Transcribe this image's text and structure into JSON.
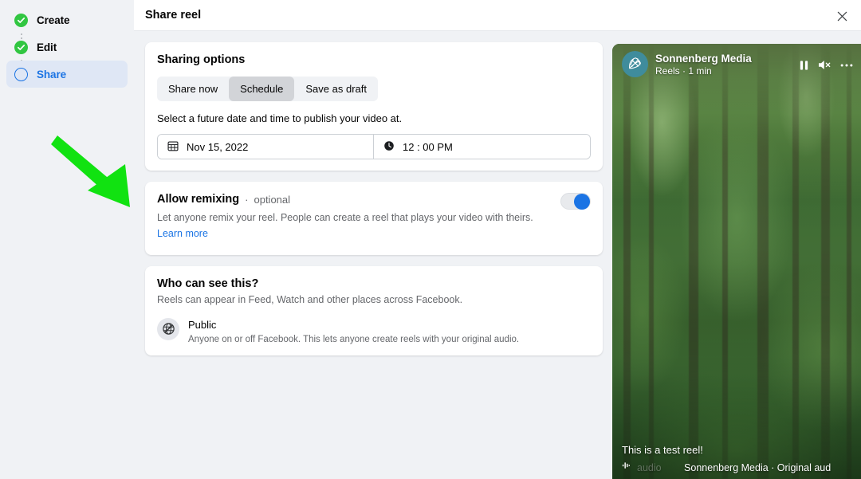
{
  "sidebar": {
    "steps": [
      {
        "label": "Create",
        "state": "done",
        "icon": "check-circle-icon"
      },
      {
        "label": "Edit",
        "state": "done",
        "icon": "check-circle-icon"
      },
      {
        "label": "Share",
        "state": "active",
        "icon": "empty-circle-icon"
      }
    ]
  },
  "header": {
    "title": "Share reel",
    "close_icon": "close-icon"
  },
  "sharing_options": {
    "title": "Sharing options",
    "tabs": [
      {
        "label": "Share now",
        "selected": false
      },
      {
        "label": "Schedule",
        "selected": true
      },
      {
        "label": "Save as draft",
        "selected": false
      }
    ],
    "helper_text": "Select a future date and time to publish your video at.",
    "date": {
      "icon": "calendar-icon",
      "value": "Nov 15, 2022"
    },
    "time": {
      "icon": "clock-icon",
      "value": "12 : 00 PM"
    }
  },
  "remixing": {
    "title": "Allow remixing",
    "separator": "·",
    "optional_label": "optional",
    "description": "Let anyone remix your reel. People can create a reel that plays your video with theirs.",
    "learn_more": "Learn more",
    "toggle_on": true,
    "toggle_color": "#1b74e4"
  },
  "visibility": {
    "title": "Who can see this?",
    "description": "Reels can appear in Feed, Watch and other places across Facebook.",
    "option": {
      "icon": "globe-icon",
      "name": "Public",
      "description": "Anyone on or off Facebook. This lets anyone create reels with your original audio."
    }
  },
  "preview": {
    "account_name": "Sonnenberg Media",
    "meta": "Reels · 1 min",
    "avatar_icon": "brand-logo-icon",
    "controls": [
      {
        "icon": "pause-icon"
      },
      {
        "icon": "speaker-muted-icon"
      },
      {
        "icon": "more-options-icon"
      }
    ],
    "caption": "This is a test reel!",
    "audio_icon": "audio-wave-icon",
    "audio_ghost_text": "audio",
    "audio_text": "Sonnenberg Media · Original aud"
  },
  "annotation": {
    "arrow_color": "#11e211",
    "points_to": "Allow remixing"
  }
}
